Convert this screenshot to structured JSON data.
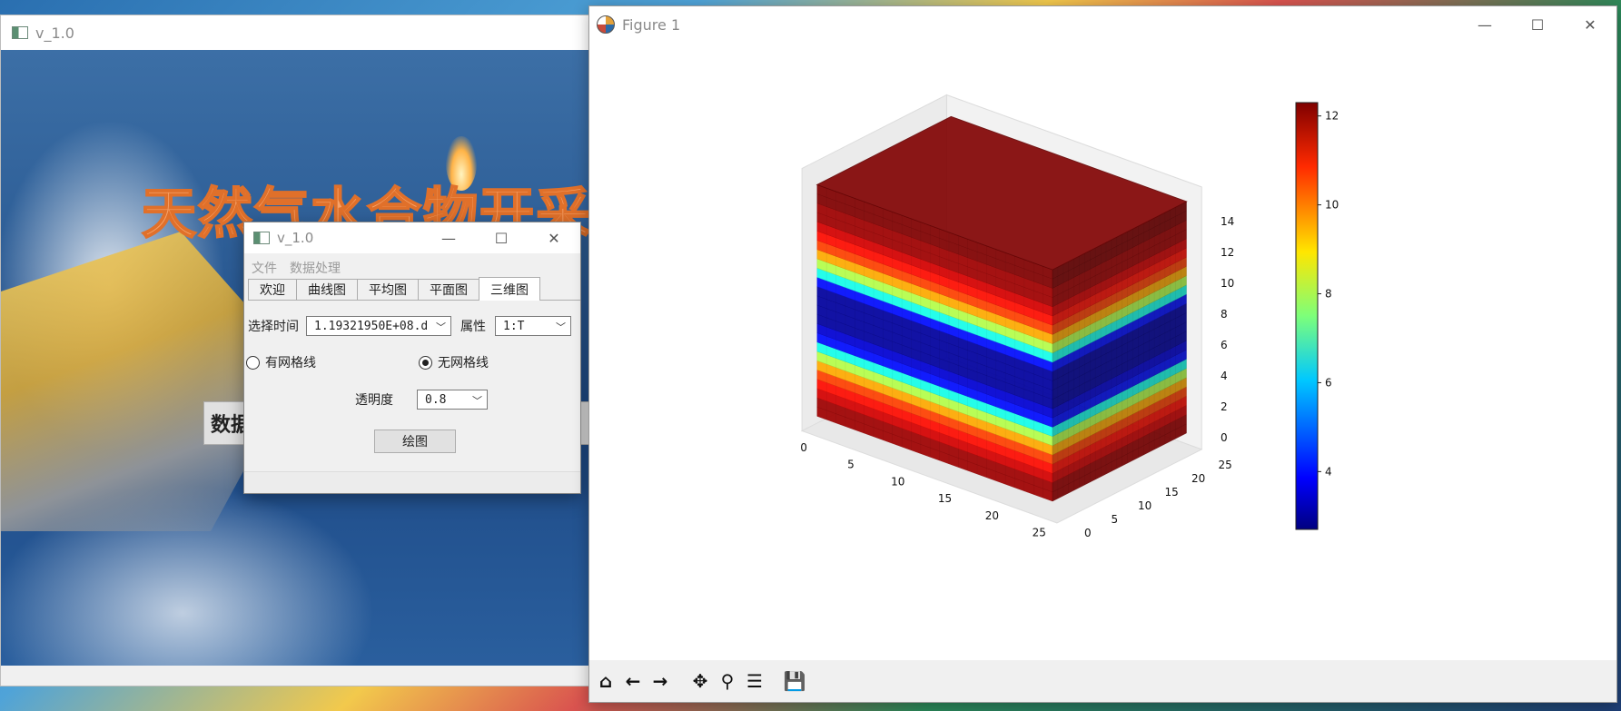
{
  "background_window": {
    "title": "v_1.0",
    "banner_title": "天然气水合物开采模拟",
    "data_button_label": "数据"
  },
  "dialog": {
    "title": "v_1.0",
    "controls": {
      "minimize": "—",
      "maximize": "☐",
      "close": "✕"
    },
    "menu": [
      "文件",
      "数据处理"
    ],
    "tabs": [
      "欢迎",
      "曲线图",
      "平均图",
      "平面图",
      "三维图"
    ],
    "active_tab": "三维图",
    "time_label": "选择时间",
    "time_value": "1.19321950E+08.d",
    "attr_label": "属性",
    "attr_value": "1:T",
    "grid_on_label": "有网格线",
    "grid_off_label": "无网格线",
    "selected_grid_option": "无网格线",
    "opacity_label": "透明度",
    "opacity_value": "0.8",
    "plot_button": "绘图"
  },
  "figure_window": {
    "title": "Figure 1",
    "controls": {
      "minimize": "—",
      "maximize": "☐",
      "close": "✕"
    },
    "toolbar": [
      {
        "name": "home-icon",
        "glyph": "⌂"
      },
      {
        "name": "back-arrow-icon",
        "glyph": "←"
      },
      {
        "name": "forward-arrow-icon",
        "glyph": "→"
      },
      {
        "name": "pan-icon",
        "glyph": "✥"
      },
      {
        "name": "zoom-icon",
        "glyph": "⚲"
      },
      {
        "name": "configure-subplots-icon",
        "glyph": "☰"
      },
      {
        "name": "save-icon",
        "glyph": "💾"
      }
    ]
  },
  "chart_data": {
    "type": "heatmap",
    "title": "",
    "xlabel": "",
    "ylabel": "",
    "zlabel": "",
    "x_ticks": [
      "0",
      "5",
      "10",
      "15",
      "20",
      "25"
    ],
    "y_ticks": [
      "0",
      "5",
      "10",
      "15",
      "20",
      "25"
    ],
    "z_ticks": [
      "0",
      "2",
      "4",
      "6",
      "8",
      "10",
      "12",
      "14"
    ],
    "xlim": [
      0,
      27
    ],
    "ylim": [
      0,
      27
    ],
    "zlim": [
      0,
      15
    ],
    "colormap": "jet",
    "colorbar_ticks": [
      "4",
      "6",
      "8",
      "10",
      "12"
    ],
    "colorbar_range": [
      2.7,
      12.3
    ],
    "layer_values_bottom_to_top": [
      12,
      12,
      11.5,
      11,
      10.5,
      9.5,
      8,
      6.5,
      4,
      3.5,
      3,
      3,
      3,
      3,
      4,
      6.5,
      8,
      9.5,
      10.5,
      11,
      11.5,
      12,
      12,
      12.3,
      12.3
    ]
  }
}
